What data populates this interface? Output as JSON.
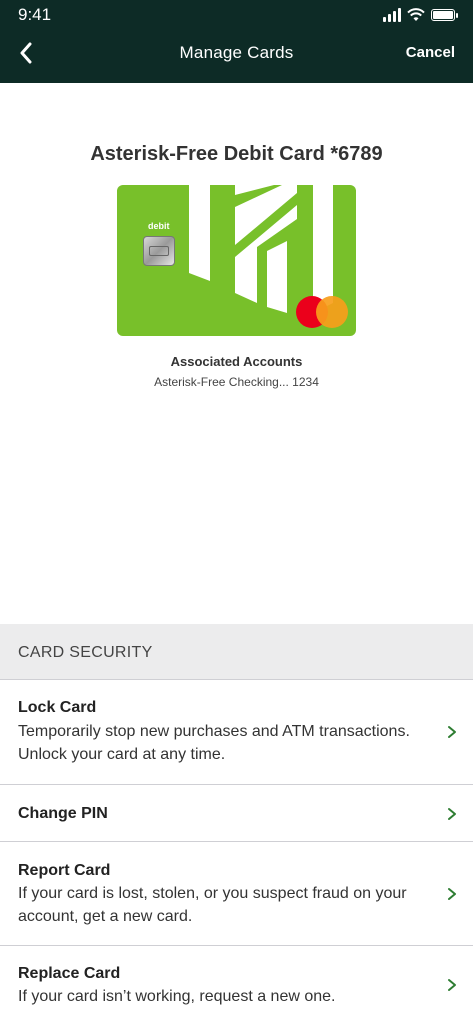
{
  "status_bar": {
    "time": "9:41"
  },
  "header": {
    "title": "Manage Cards",
    "cancel_label": "Cancel"
  },
  "card": {
    "title": "Asterisk-Free Debit Card *6789",
    "type_label": "debit",
    "color": "#78c02a"
  },
  "associated": {
    "title": "Associated Accounts",
    "account": "Asterisk-Free Checking... 1234"
  },
  "section": {
    "title": "CARD SECURITY",
    "items": [
      {
        "label": "Lock Card",
        "description": "Temporarily stop new purchases and ATM transactions. Unlock your card at any time."
      },
      {
        "label": "Change PIN",
        "description": ""
      },
      {
        "label": "Report Card",
        "description": "If your card is lost, stolen, or you suspect fraud on your account, get a new card."
      },
      {
        "label": "Replace Card",
        "description": "If your card isn’t working, request a new one."
      }
    ]
  },
  "colors": {
    "header_bg": "#0d2b26",
    "accent_green": "#2e7d32"
  }
}
